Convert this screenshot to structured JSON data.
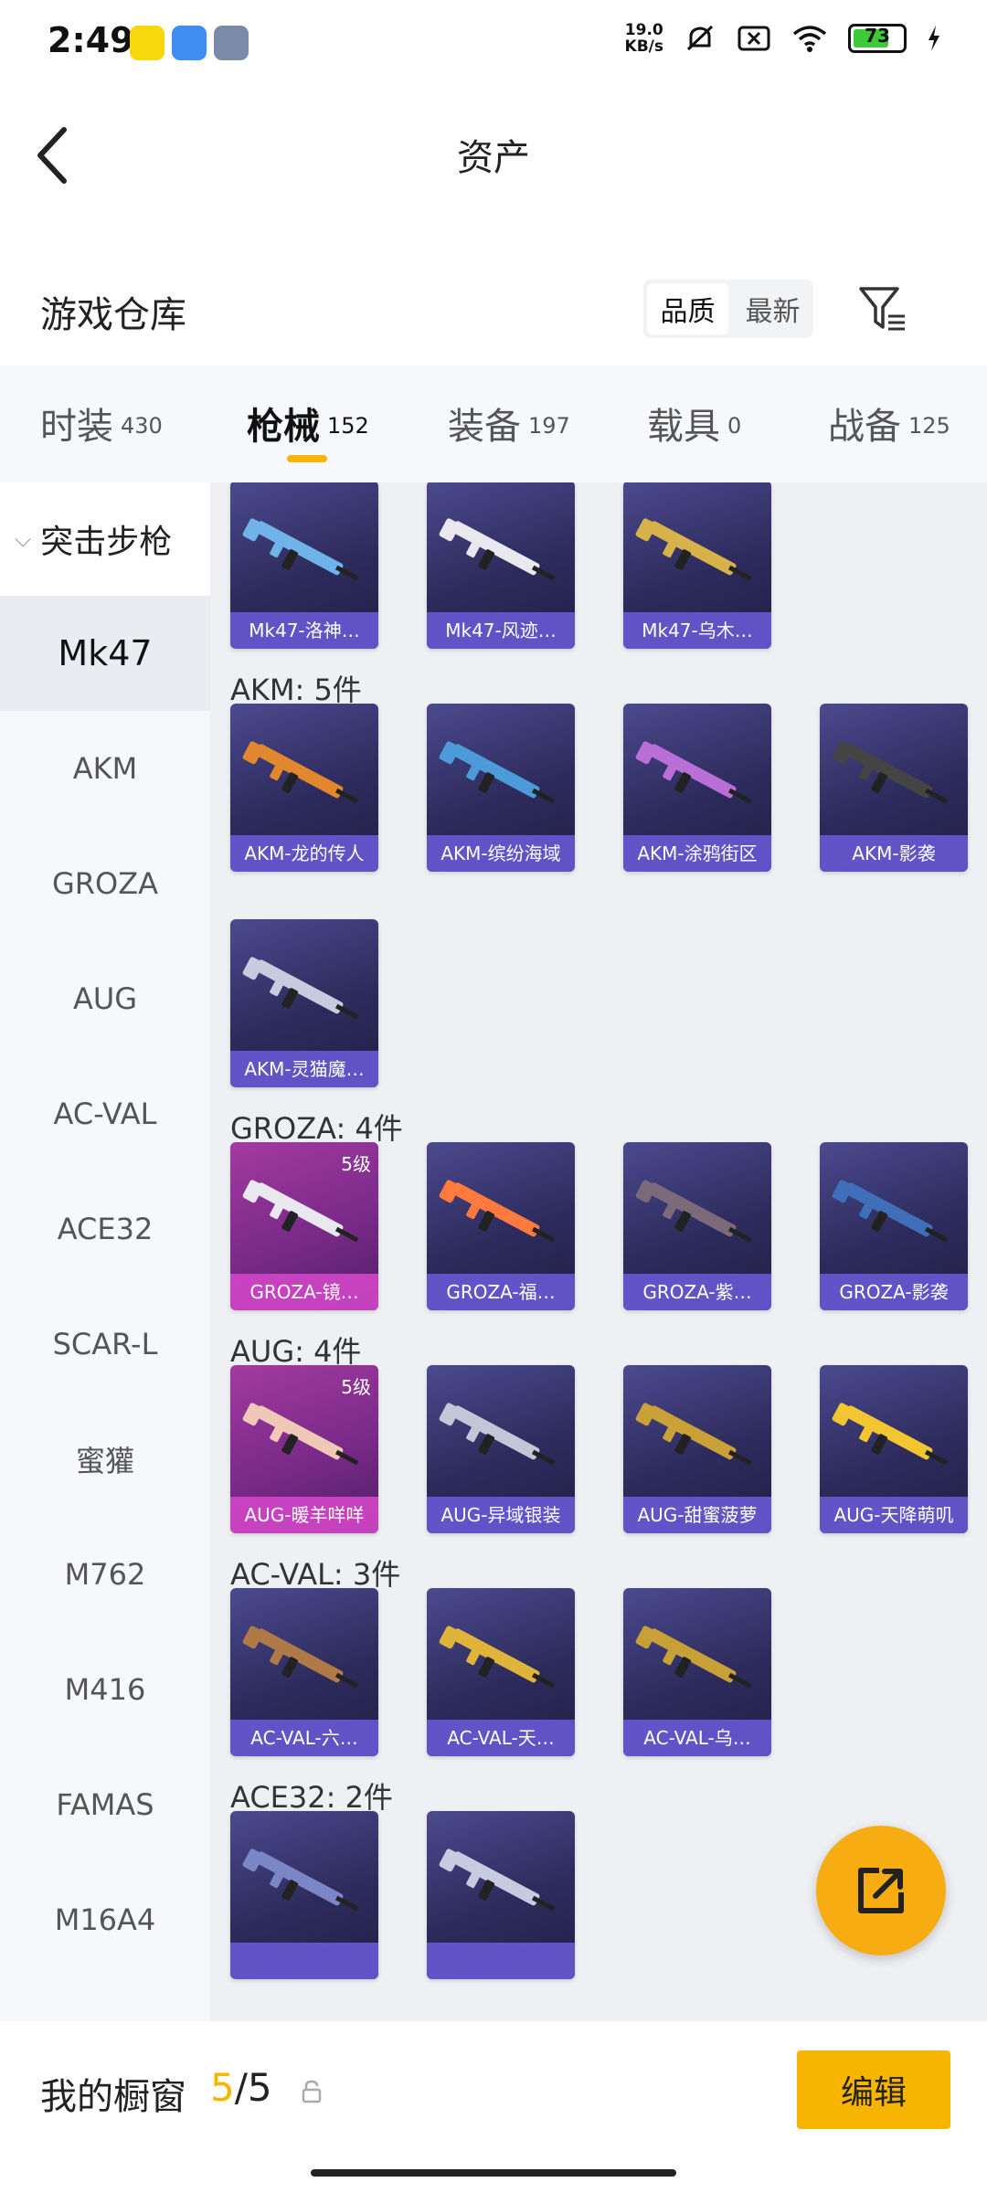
{
  "status_bar": {
    "time": "2:49",
    "net_speed": "19.0",
    "net_speed_unit": "KB/s",
    "battery": "73",
    "battery_level": 0.73,
    "accent_battery": "#3ec93a"
  },
  "header": {
    "title": "资产",
    "back_icon": "chevron-left-icon"
  },
  "warehouse": {
    "title": "游戏仓库",
    "sort_options": [
      "品质",
      "最新"
    ],
    "selected_sort": "品质",
    "filter_icon": "filter-icon"
  },
  "tabs": [
    {
      "label": "时装",
      "count": "430"
    },
    {
      "label": "枪械",
      "count": "152",
      "active": true
    },
    {
      "label": "装备",
      "count": "197"
    },
    {
      "label": "载具",
      "count": "0"
    },
    {
      "label": "战备",
      "count": "125"
    }
  ],
  "sidebar": {
    "group": "突击步枪",
    "items": [
      "Mk47",
      "AKM",
      "GROZA",
      "AUG",
      "AC-VAL",
      "ACE32",
      "SCAR-L",
      "蜜獾",
      "M762",
      "M416",
      "FAMAS",
      "M16A4"
    ],
    "active_item": "Mk47"
  },
  "sections": [
    {
      "title": "",
      "items": [
        {
          "name": "Mk47-洛神…"
        },
        {
          "name": "Mk47-风迹…"
        },
        {
          "name": "Mk47-乌木…"
        }
      ]
    },
    {
      "title": "AKM: 5件",
      "items": [
        {
          "name": "AKM-龙的传人"
        },
        {
          "name": "AKM-缤纷海域"
        },
        {
          "name": "AKM-涂鸦街区"
        },
        {
          "name": "AKM-影袭"
        },
        {
          "name": "AKM-灵猫魔…"
        }
      ]
    },
    {
      "title": "GROZA: 4件",
      "items": [
        {
          "name": "GROZA-镜…",
          "level": "5级",
          "rarity": "pink"
        },
        {
          "name": "GROZA-福…"
        },
        {
          "name": "GROZA-紫…"
        },
        {
          "name": "GROZA-影袭"
        }
      ]
    },
    {
      "title": "AUG: 4件",
      "items": [
        {
          "name": "AUG-暖羊咩咩",
          "level": "5级",
          "rarity": "pink"
        },
        {
          "name": "AUG-异域银装"
        },
        {
          "name": "AUG-甜蜜菠萝"
        },
        {
          "name": "AUG-天降萌叽"
        }
      ]
    },
    {
      "title": "AC-VAL: 3件",
      "items": [
        {
          "name": "AC-VAL-六…"
        },
        {
          "name": "AC-VAL-天…"
        },
        {
          "name": "AC-VAL-乌…"
        }
      ]
    },
    {
      "title": "ACE32: 2件",
      "items": [
        {
          "name": ""
        },
        {
          "name": ""
        }
      ]
    }
  ],
  "bottom": {
    "window_label": "我的橱窗",
    "window_current": "5",
    "window_total": "/5",
    "edit_label": "编辑"
  },
  "colors": {
    "accent": "#f7b500",
    "fab": "#f7ad12",
    "card_bg": "#2d2b5c",
    "card_name_bar": "#6c5cdc",
    "rare_card": "#a33aa1"
  },
  "icons": {
    "fab": "share-icon",
    "lock": "lock-icon",
    "group_chevron": "chevron-down-icon"
  }
}
